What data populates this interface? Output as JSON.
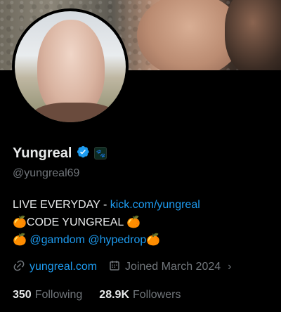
{
  "profile": {
    "display_name": "Yungreal",
    "handle": "@yungreal69",
    "verified": true,
    "affiliate_badge_icon": "paw-icon",
    "accent_color": "#1d9bf0"
  },
  "bio": {
    "line1_text": "LIVE EVERYDAY - ",
    "line1_link": "kick.com/yungreal",
    "line2_emoji": "🍊",
    "line2_text": "CODE YUNGREAL ",
    "line2_emoji_end": "🍊",
    "line3_emoji": "🍊",
    "line3_mention1": "@gamdom",
    "line3_mention2": "@hypedrop",
    "line3_emoji_end": "🍊"
  },
  "meta": {
    "website": "yungreal.com",
    "joined": "Joined March 2024",
    "link_icon": "link-icon",
    "calendar_icon": "calendar-icon"
  },
  "stats": {
    "following_count": "350",
    "following_label": "Following",
    "followers_count": "28.9K",
    "followers_label": "Followers"
  }
}
